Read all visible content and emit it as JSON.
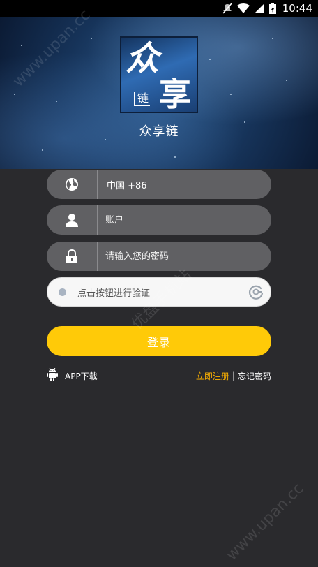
{
  "status_bar": {
    "time": "10:44",
    "icons": [
      "mute-icon",
      "wifi-icon",
      "signal-icon",
      "battery-icon"
    ]
  },
  "header": {
    "logo_chars": [
      "众",
      "享",
      "链"
    ],
    "app_title": "众享链"
  },
  "form": {
    "country": {
      "icon": "globe-icon",
      "value": "中国 +86"
    },
    "account": {
      "icon": "user-icon",
      "placeholder": "账户"
    },
    "password": {
      "icon": "lock-icon",
      "placeholder": "请输入您的密码"
    },
    "verify": {
      "label": "点击按钮进行验证"
    },
    "login_label": "登录"
  },
  "footer_links": {
    "download_icon": "android-icon",
    "download_label": "APP下载",
    "register_label": "立即注册",
    "divider": "|",
    "forgot_label": "忘记密码"
  },
  "watermarks": [
    "www.upan.cc",
    "优盘手机站",
    "www.upan.cc"
  ],
  "colors": {
    "background": "#2a2a2d",
    "field": "#606063",
    "login_button": "#ffca08",
    "register_link": "#ffb300"
  }
}
